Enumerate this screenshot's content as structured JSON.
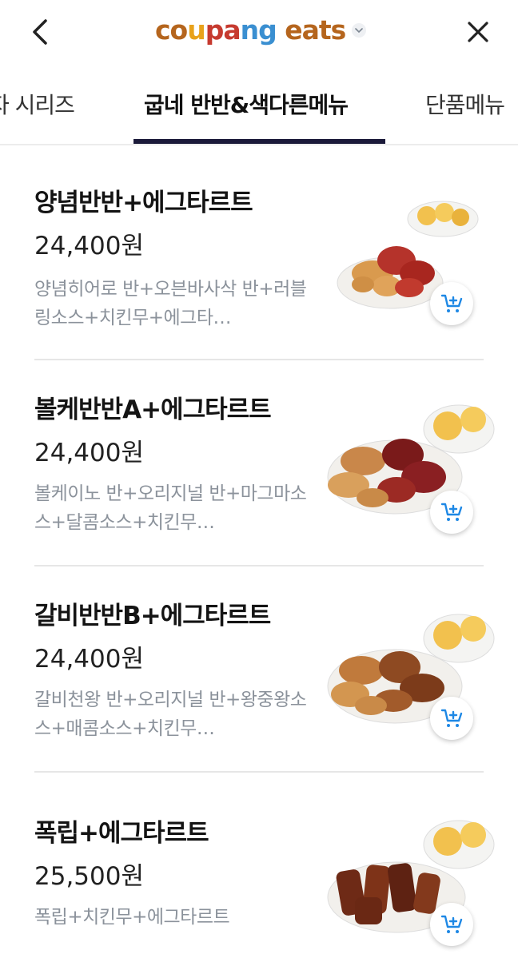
{
  "header": {
    "logo_parts": [
      "co",
      "u",
      "pa",
      "ng",
      " ",
      "eats"
    ],
    "back_icon": "chevron-left-icon",
    "close_icon": "close-icon"
  },
  "tabs": [
    {
      "label": "자 시리즈",
      "active": false
    },
    {
      "label": "굽네 반반&색다른메뉴",
      "active": true
    },
    {
      "label": "단품메뉴",
      "active": false
    }
  ],
  "menu_items": [
    {
      "name": "양념반반+에그타르트",
      "price": "24,400원",
      "description": "양념히어로 반+오븐바사삭 반+러블링소스+치킨무+에그타…"
    },
    {
      "name": "볼케반반A+에그타르트",
      "price": "24,400원",
      "description": "볼케이노 반+오리지널 반+마그마소스+달콤소스+치킨무…"
    },
    {
      "name": "갈비반반B+에그타르트",
      "price": "24,400원",
      "description": "갈비천왕 반+오리지널 반+왕중왕소스+매콤소스+치킨무…"
    },
    {
      "name": "폭립+에그타르트",
      "price": "25,500원",
      "description": "폭립+치킨무+에그타르트"
    }
  ],
  "colors": {
    "accent_blue": "#1e88e5",
    "tab_underline": "#1b1a3a",
    "desc_gray": "#8b929b"
  }
}
